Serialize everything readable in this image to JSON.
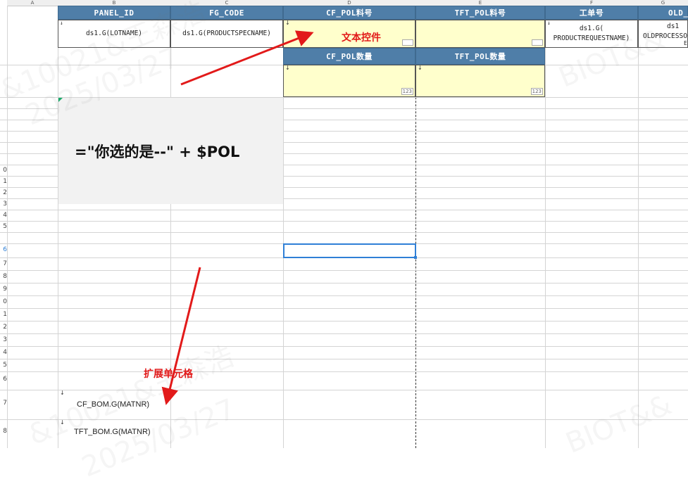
{
  "columns": [
    "A",
    "B",
    "C",
    "D",
    "E",
    "F",
    "G"
  ],
  "row_numbers": [
    "0",
    "1",
    "2",
    "3",
    "4",
    "5",
    "6",
    "7",
    "8",
    "9",
    "0",
    "1",
    "2",
    "3",
    "4",
    "5",
    "6",
    "7",
    "8"
  ],
  "headers": {
    "panel_id": "PANEL_ID",
    "fg_code": "FG_CODE",
    "cf_pol": "CF_POL料号",
    "tft_pol": "TFT_POL料号",
    "work_order": "工单号",
    "old": "OLD_",
    "cf_pol_qty": "CF_POL数量",
    "tft_pol_qty": "TFT_POL数量"
  },
  "cells": {
    "lotname": "ds1.G(LOTNAME)",
    "productspec": "ds1.G(PRODUCTSPECNAME)",
    "work_order_1": "ds1.G(",
    "work_order_2": "PRODUCTREQUESTNAME)",
    "old_1": "ds1",
    "old_2": "OLDPROCESSO",
    "old_3": "E",
    "cf_bom": "CF_BOM.G(MATNR)",
    "tft_bom": "TFT_BOM.G(MATNR)",
    "num_tag": "123"
  },
  "formula_text": "=\"你选的是--\" + $POL",
  "annotations": {
    "text_control": "文本控件",
    "expand_cell": "扩展单元格"
  },
  "watermarks": [
    "&10021&王森浩",
    "2025/03/27",
    "BIOT&&",
    "BIOT&&"
  ],
  "colors": {
    "header_blue": "#4f7ea8",
    "input_yellow": "#ffffcc",
    "annotation_red": "#e21a1a",
    "selection_blue": "#2f7fd6"
  }
}
